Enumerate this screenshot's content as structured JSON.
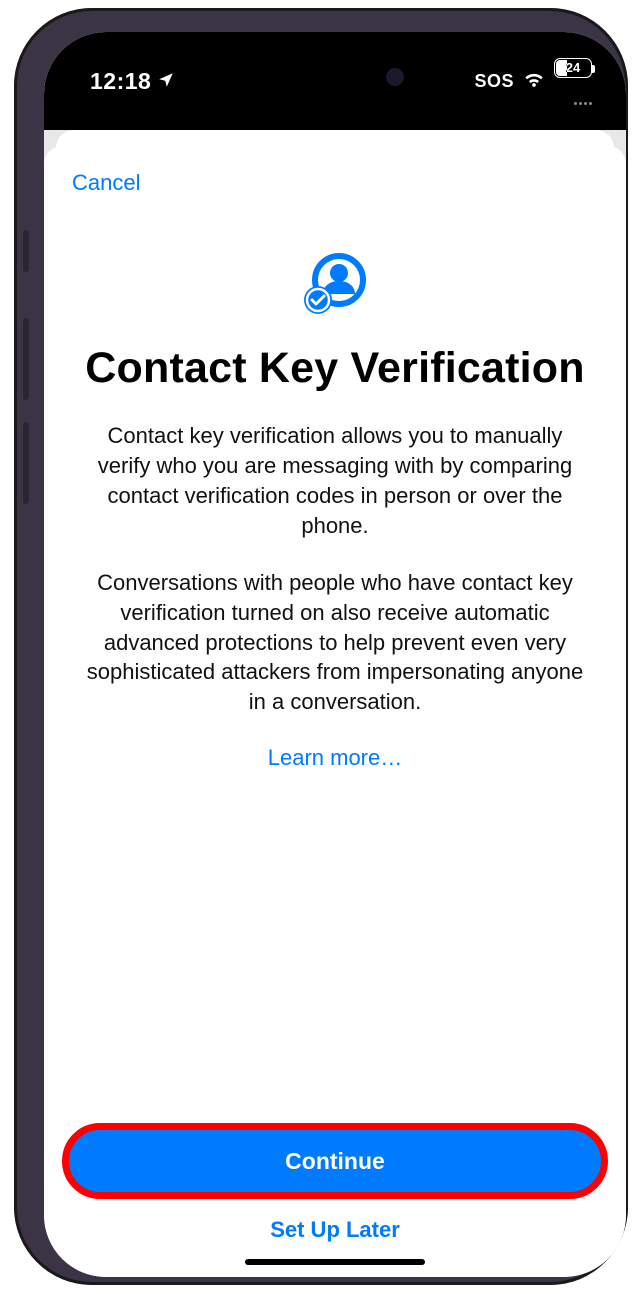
{
  "status_bar": {
    "time": "12:18",
    "sos_label": "SOS",
    "battery_pct": "24"
  },
  "nav": {
    "cancel_label": "Cancel"
  },
  "hero": {
    "title": "Contact Key Verification",
    "paragraph_1": "Contact key verification allows you to manually verify who you are messaging with by comparing contact verification codes in person or over the phone.",
    "paragraph_2": "Conversations with people who have contact key verification turned on also receive automatic advanced protections to help prevent even very sophisticated attackers from impersonating anyone in a conversation.",
    "learn_more_label": "Learn more…"
  },
  "footer": {
    "primary_label": "Continue",
    "secondary_label": "Set Up Later"
  },
  "colors": {
    "accent": "#007aff",
    "annotation": "#ff0000"
  }
}
